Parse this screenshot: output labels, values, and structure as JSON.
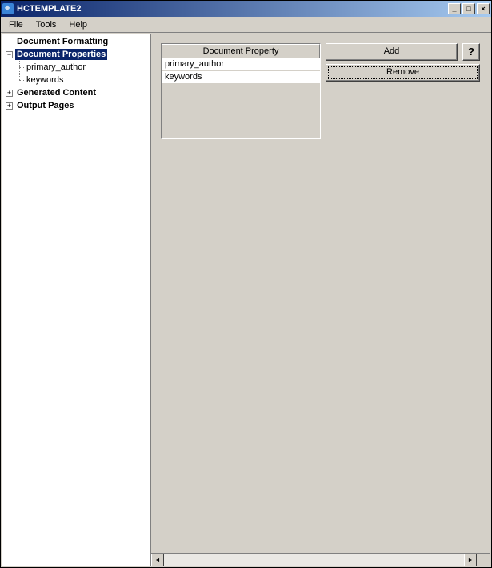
{
  "window": {
    "title": "HCTEMPLATE2"
  },
  "menu": {
    "file": "File",
    "tools": "Tools",
    "help": "Help"
  },
  "tree": {
    "doc_formatting": "Document Formatting",
    "doc_properties": "Document Properties",
    "primary_author": "primary_author",
    "keywords": "keywords",
    "generated_content": "Generated Content",
    "output_pages": "Output Pages"
  },
  "panel": {
    "header": "Document Property",
    "rows": {
      "r0": "primary_author",
      "r1": "keywords"
    }
  },
  "buttons": {
    "add": "Add",
    "remove": "Remove",
    "help": "?"
  }
}
